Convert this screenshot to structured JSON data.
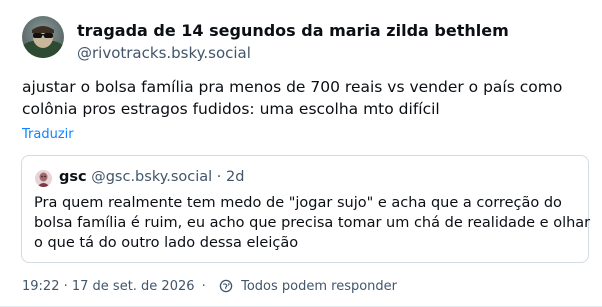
{
  "post": {
    "author": {
      "display_name": "tragada de 14 segundos da maria zilda bethlem",
      "handle": "@rivotracks.bsky.social"
    },
    "text_lines": [
      "ajustar o bolsa família pra menos de 700 reais vs vender o país como",
      "colônia pros estragos fudidos: uma escolha mto difícil"
    ],
    "translate_label": "Traduzir",
    "quote": {
      "display_name": "gsc",
      "handle": "@gsc.bsky.social",
      "separator": "·",
      "time_ago": "2d",
      "text_lines": [
        "Pra quem realmente tem medo de \"jogar sujo\" e acha que a correção do",
        "bolsa família é ruim, eu acho que precisa tomar um chá de realidade e olhar",
        "o que tá do outro lado dessa eleição"
      ]
    },
    "footer": {
      "timestamp": "19:22 · 17 de set. de 2026",
      "separator": "·",
      "reply_setting": "Todos podem responder",
      "reply_icon": "globe-reply-icon"
    }
  },
  "colors": {
    "link": "#1083fe",
    "muted": "#42566b",
    "text": "#0b0f14",
    "border": "#d4dbe2"
  }
}
